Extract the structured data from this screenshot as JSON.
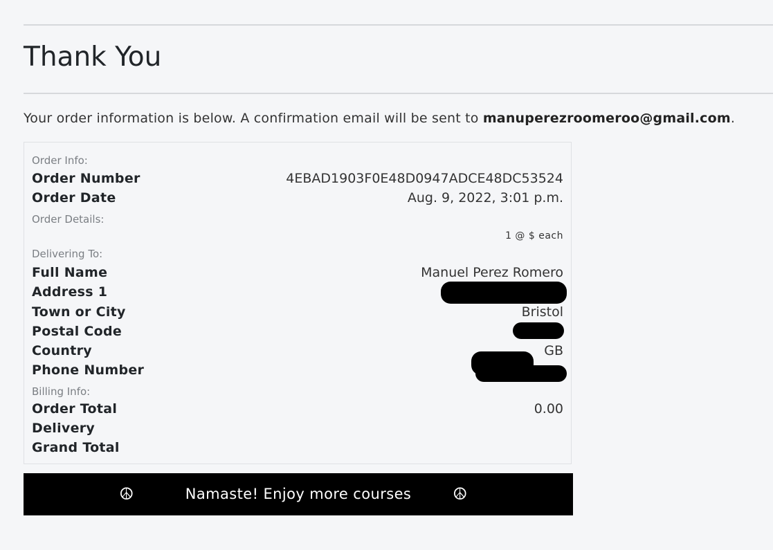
{
  "page": {
    "title": "Thank You",
    "intro_text": "Your order information is below. A confirmation email will be sent to ",
    "email": "manuperezroomeroo@gmail.com",
    "intro_end": "."
  },
  "order_info": {
    "section_label": "Order Info:",
    "order_number_label": "Order Number",
    "order_number": "4EBAD1903F0E48D0947ADCE48DC53524",
    "order_date_label": "Order Date",
    "order_date": "Aug. 9, 2022, 3:01 p.m."
  },
  "order_details": {
    "section_label": "Order Details:",
    "line_item": "1 @ $ each"
  },
  "delivery": {
    "section_label": "Delivering To:",
    "full_name_label": "Full Name",
    "full_name": "Manuel Perez Romero",
    "address1_label": "Address 1",
    "town_label": "Town or City",
    "town": "Bristol",
    "postal_code_label": "Postal Code",
    "country_label": "Country",
    "country": "GB",
    "phone_label": "Phone Number"
  },
  "billing": {
    "section_label": "Billing Info:",
    "order_total_label": "Order Total",
    "order_total": "0.00",
    "delivery_label": "Delivery",
    "grand_total_label": "Grand Total"
  },
  "cta": {
    "label": "Namaste! Enjoy more courses",
    "icon": "peace-icon",
    "icon_glyph": "☮"
  },
  "colors": {
    "background": "#f5f6f8",
    "cta_background": "#000000",
    "cta_text": "#ffffff"
  }
}
